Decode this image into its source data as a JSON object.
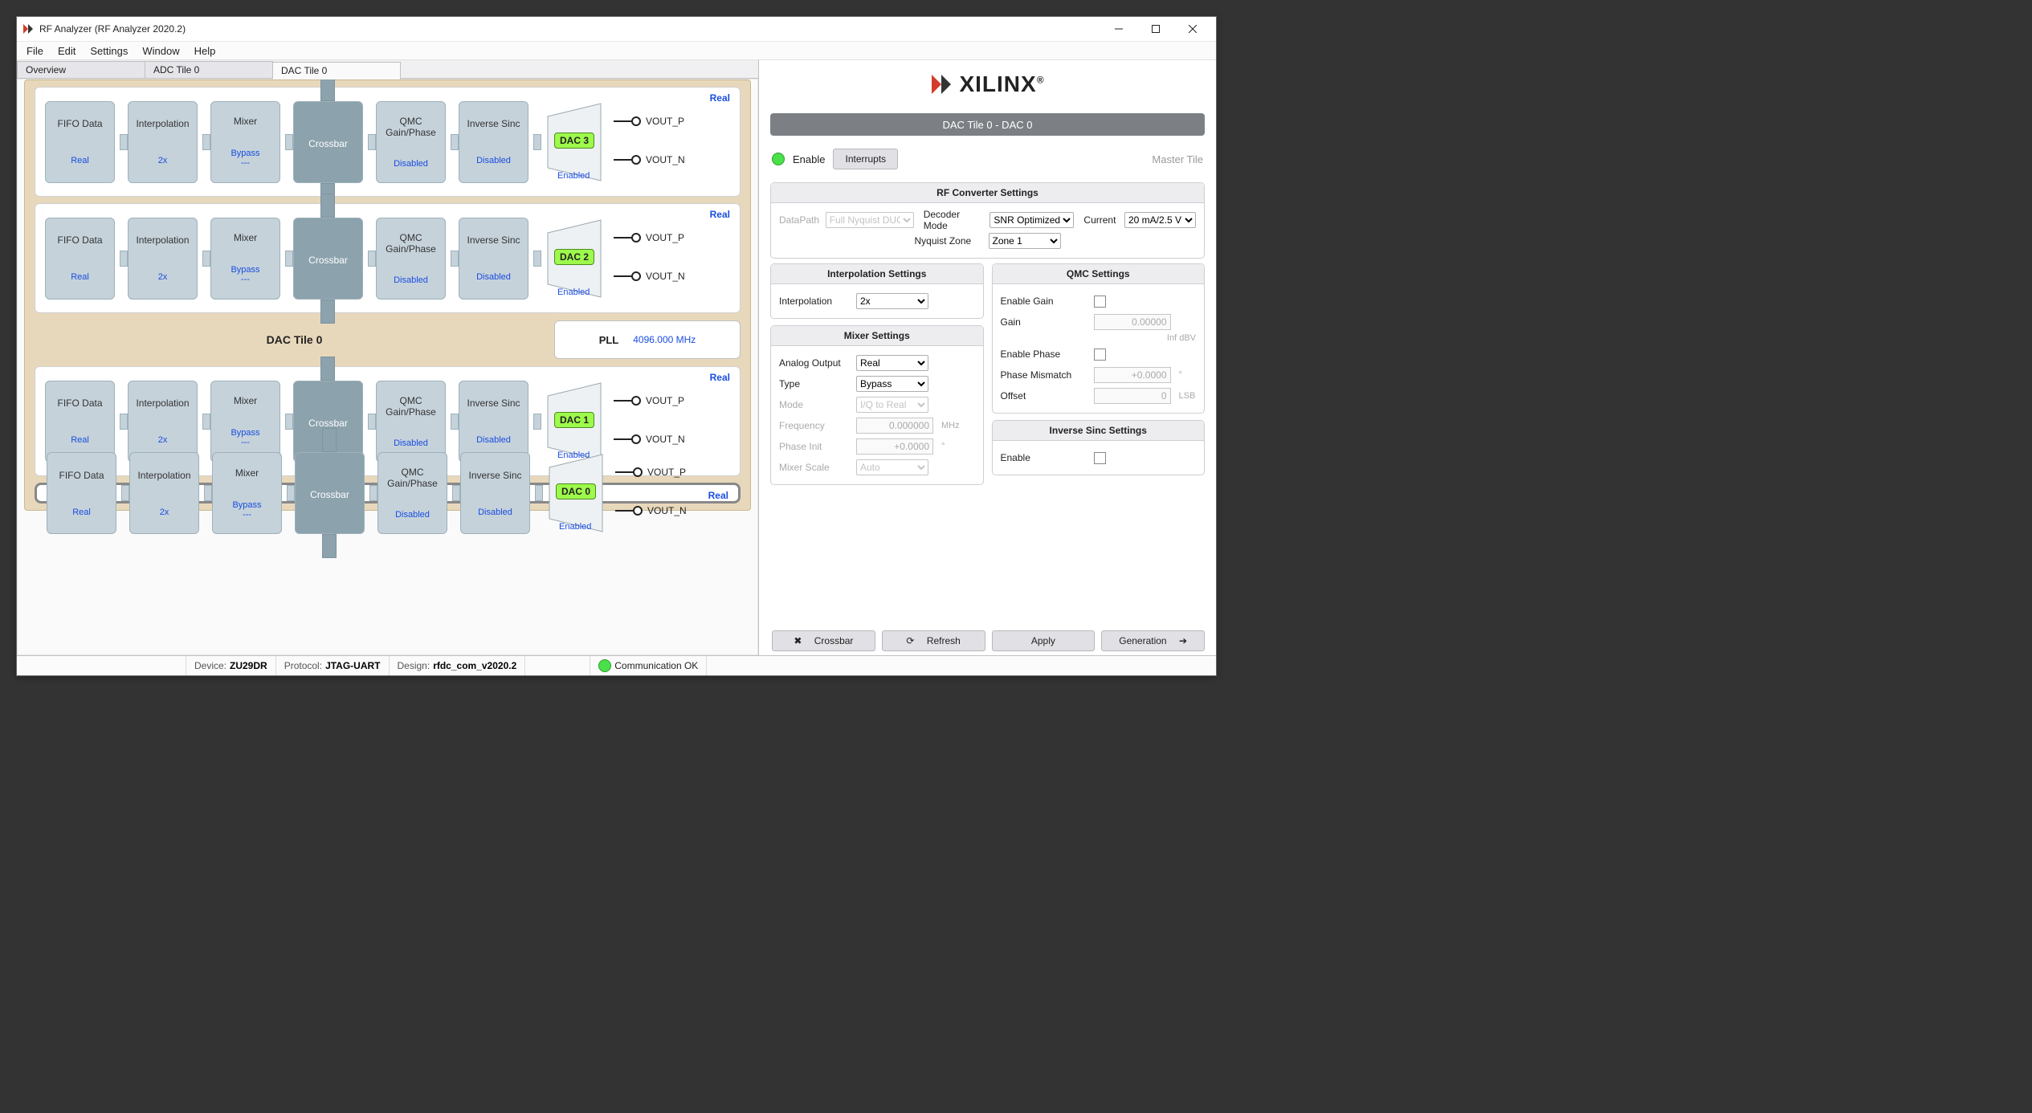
{
  "window": {
    "title": "RF Analyzer (RF Analyzer 2020.2)"
  },
  "menu": [
    "File",
    "Edit",
    "Settings",
    "Window",
    "Help"
  ],
  "tabs": [
    {
      "label": "Overview",
      "active": false
    },
    {
      "label": "ADC Tile 0",
      "active": false
    },
    {
      "label": "DAC Tile 0",
      "active": true
    }
  ],
  "tile_name": "DAC Tile 0",
  "pll": {
    "label": "PLL",
    "freq": "4096.000 MHz"
  },
  "rows": [
    {
      "dac": "DAC 3",
      "enabled": "Enabled",
      "badge": "Real",
      "blocks": [
        {
          "t": "FIFO Data",
          "b": "Real"
        },
        {
          "t": "Interpolation",
          "b": "2x"
        },
        {
          "t": "Mixer",
          "b": "Bypass",
          "b2": "---"
        },
        {
          "t": "Crossbar",
          "dark": true
        },
        {
          "t": "QMC Gain/Phase",
          "b": "Disabled"
        },
        {
          "t": "Inverse Sinc",
          "b": "Disabled"
        }
      ],
      "outs": [
        "VOUT_P",
        "VOUT_N"
      ]
    },
    {
      "dac": "DAC 2",
      "enabled": "Enabled",
      "badge": "Real",
      "blocks": [
        {
          "t": "FIFO Data",
          "b": "Real"
        },
        {
          "t": "Interpolation",
          "b": "2x"
        },
        {
          "t": "Mixer",
          "b": "Bypass",
          "b2": "---"
        },
        {
          "t": "Crossbar",
          "dark": true
        },
        {
          "t": "QMC Gain/Phase",
          "b": "Disabled"
        },
        {
          "t": "Inverse Sinc",
          "b": "Disabled"
        }
      ],
      "outs": [
        "VOUT_P",
        "VOUT_N"
      ]
    },
    {
      "dac": "DAC 1",
      "enabled": "Enabled",
      "badge": "Real",
      "blocks": [
        {
          "t": "FIFO Data",
          "b": "Real"
        },
        {
          "t": "Interpolation",
          "b": "2x"
        },
        {
          "t": "Mixer",
          "b": "Bypass",
          "b2": "---"
        },
        {
          "t": "Crossbar",
          "dark": true
        },
        {
          "t": "QMC Gain/Phase",
          "b": "Disabled"
        },
        {
          "t": "Inverse Sinc",
          "b": "Disabled"
        }
      ],
      "outs": [
        "VOUT_P",
        "VOUT_N"
      ]
    },
    {
      "dac": "DAC 0",
      "enabled": "Enabled",
      "badge": "Real",
      "selected": true,
      "blocks": [
        {
          "t": "FIFO Data",
          "b": "Real"
        },
        {
          "t": "Interpolation",
          "b": "2x"
        },
        {
          "t": "Mixer",
          "b": "Bypass",
          "b2": "---"
        },
        {
          "t": "Crossbar",
          "dark": true
        },
        {
          "t": "QMC Gain/Phase",
          "b": "Disabled"
        },
        {
          "t": "Inverse Sinc",
          "b": "Disabled"
        }
      ],
      "outs": [
        "VOUT_P",
        "VOUT_N"
      ]
    }
  ],
  "right": {
    "logo": "XILINX",
    "header": "DAC Tile 0 - DAC 0",
    "enable": "Enable",
    "interrupts": "Interrupts",
    "master": "Master Tile",
    "conv": {
      "title": "RF Converter Settings",
      "datapath": {
        "label": "DataPath",
        "value": "Full Nyquist DUC"
      },
      "decoder": {
        "label": "Decoder Mode",
        "value": "SNR Optimized"
      },
      "current": {
        "label": "Current",
        "value": "20 mA/2.5 V"
      },
      "nyquist": {
        "label": "Nyquist Zone",
        "value": "Zone 1"
      }
    },
    "interp": {
      "title": "Interpolation Settings",
      "label": "Interpolation",
      "value": "2x"
    },
    "mixer": {
      "title": "Mixer Settings",
      "analog": {
        "label": "Analog Output",
        "value": "Real"
      },
      "type": {
        "label": "Type",
        "value": "Bypass"
      },
      "mode": {
        "label": "Mode",
        "value": "I/Q to Real"
      },
      "freq": {
        "label": "Frequency",
        "value": "0.000000",
        "unit": "MHz"
      },
      "phase": {
        "label": "Phase Init",
        "value": "+0.0000",
        "unit": "°"
      },
      "scale": {
        "label": "Mixer Scale",
        "value": "Auto"
      }
    },
    "qmc": {
      "title": "QMC Settings",
      "egain": {
        "label": "Enable Gain"
      },
      "gain": {
        "label": "Gain",
        "value": "0.00000",
        "sub": "Inf dBV"
      },
      "ephase": {
        "label": "Enable Phase"
      },
      "mismatch": {
        "label": "Phase Mismatch",
        "value": "+0.0000",
        "unit": "°"
      },
      "offset": {
        "label": "Offset",
        "value": "0",
        "unit": "LSB"
      }
    },
    "invsinc": {
      "title": "Inverse Sinc Settings",
      "label": "Enable"
    },
    "btns": {
      "crossbar": "Crossbar",
      "refresh": "Refresh",
      "apply": "Apply",
      "generation": "Generation"
    }
  },
  "status": {
    "device": {
      "k": "Device:",
      "v": "ZU29DR"
    },
    "proto": {
      "k": "Protocol:",
      "v": "JTAG-UART"
    },
    "design": {
      "k": "Design:",
      "v": "rfdc_com_v2020.2"
    },
    "comm": "Communication OK"
  }
}
